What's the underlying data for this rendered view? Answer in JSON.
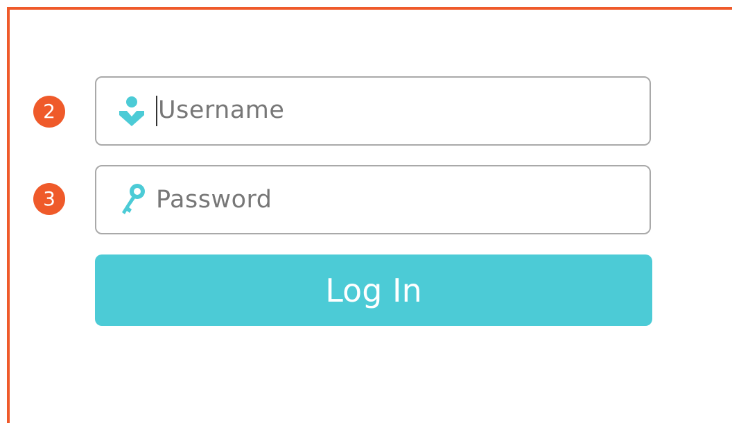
{
  "badges": {
    "username_step": "2",
    "password_step": "3"
  },
  "form": {
    "username": {
      "placeholder": "Username",
      "icon": "user-icon"
    },
    "password": {
      "placeholder": "Password",
      "icon": "key-icon"
    },
    "login_label": "Log In"
  },
  "colors": {
    "accent_orange": "#ef5a2a",
    "accent_teal": "#4ccbd6",
    "border_gray": "#a9a9a9",
    "placeholder_gray": "#777777"
  }
}
